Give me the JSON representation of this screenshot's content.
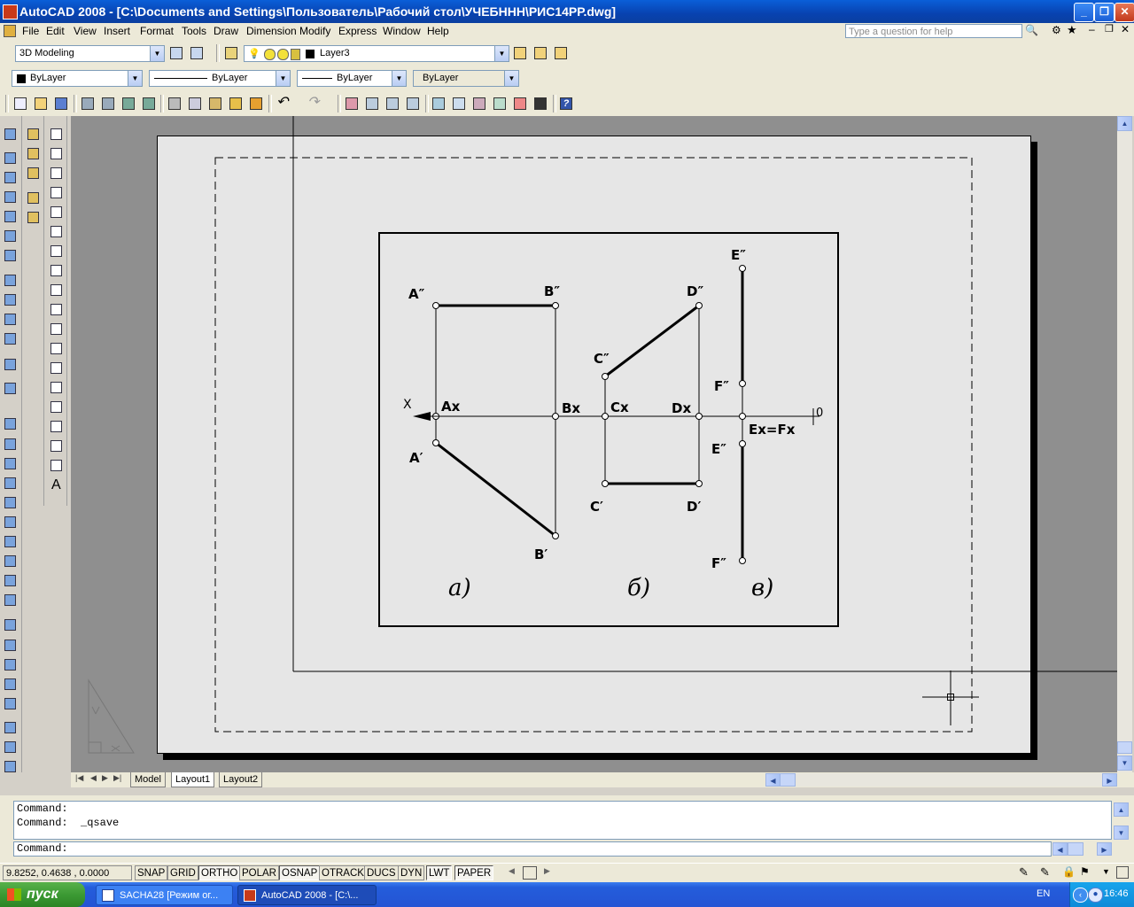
{
  "window": {
    "title": "AutoCAD 2008 - [C:\\Documents and Settings\\Пользователь\\Рабочий стол\\УЧЕБННН\\РИС14РР.dwg]"
  },
  "menu": [
    "File",
    "Edit",
    "View",
    "Insert",
    "Format",
    "Tools",
    "Draw",
    "Dimension",
    "Modify",
    "Express",
    "Window",
    "Help"
  ],
  "help_search": {
    "placeholder": "Type a question for help"
  },
  "workspace": {
    "value": "3D Modeling"
  },
  "layer": {
    "value": "Layer3"
  },
  "properties": {
    "color": "ByLayer",
    "linetype": "ByLayer",
    "lineweight": "ByLayer",
    "plotstyle": "ByLayer"
  },
  "drawing": {
    "labels": {
      "a2": "A″",
      "b2": "B″",
      "c2": "C″",
      "d2": "D″",
      "e2_top": "E″",
      "f2_mid": "F″",
      "ax": "Ax",
      "bx": "Bx",
      "cx": "Cx",
      "dx": "Dx",
      "exfx": "Ex=Fx",
      "x": "X",
      "zero": "0",
      "a1": "A′",
      "b1": "B′",
      "c1": "C′",
      "d1": "D′",
      "e1": "E″",
      "f1": "F″",
      "cap_a": "a)",
      "cap_b": "б)",
      "cap_v": "в)"
    }
  },
  "tabs": [
    "Model",
    "Layout1",
    "Layout2"
  ],
  "command": {
    "history": [
      "Command:",
      "Command:  _qsave"
    ],
    "prompt": "Command:"
  },
  "status": {
    "coords": "9.8252, 0.4638 , 0.0000",
    "toggles": [
      "SNAP",
      "GRID",
      "ORTHO",
      "POLAR",
      "OSNAP",
      "OTRACK",
      "DUCS",
      "DYN",
      "LWT",
      "PAPER"
    ]
  },
  "taskbar": {
    "start": "пуск",
    "items": [
      "SACHA28 [Режим ог...",
      "AutoCAD 2008 - [C:\\..."
    ],
    "lang": "EN",
    "time": "16:46"
  }
}
